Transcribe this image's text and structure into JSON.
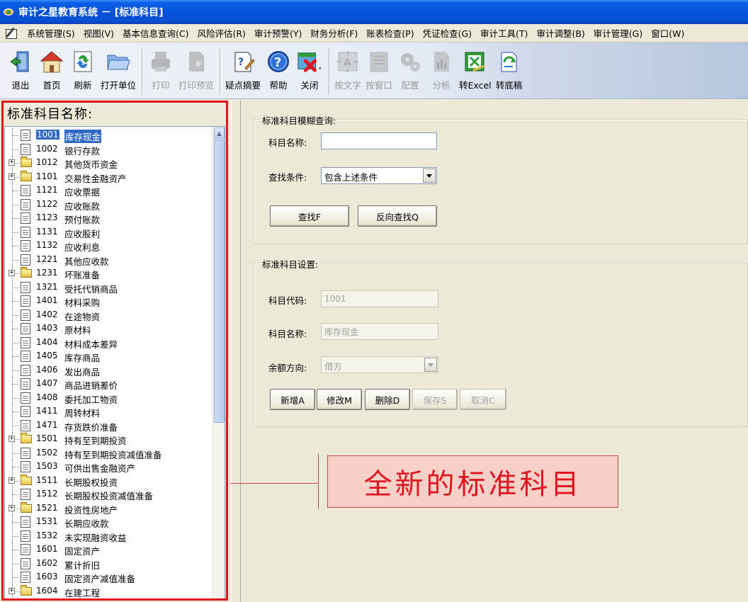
{
  "window": {
    "title": "审计之星教育系统 － [标准科目]"
  },
  "menu": [
    "系统管理(S)",
    "视图(V)",
    "基本信息查询(C)",
    "风险评估(R)",
    "审计预警(Y)",
    "财务分析(F)",
    "账表检查(P)",
    "凭证检查(G)",
    "审计工具(T)",
    "审计调整(B)",
    "审计管理(G)",
    "窗口(W)"
  ],
  "toolbar": {
    "exit": "退出",
    "home": "首页",
    "refresh": "刷新",
    "open_unit": "打开单位",
    "print": "打印",
    "print_preview": "打印预览",
    "doubt_summary": "疑点摘要",
    "help": "帮助",
    "close": "关闭",
    "by_text": "按文字",
    "by_window": "按窗口",
    "config": "配置",
    "analyze": "分析",
    "to_excel": "转Excel",
    "to_draft": "转底稿"
  },
  "left": {
    "title": "标准科目名称:",
    "tree": [
      {
        "code": "1001",
        "name": "库存现金",
        "type": "doc",
        "selected": true
      },
      {
        "code": "1002",
        "name": "银行存款",
        "type": "doc"
      },
      {
        "code": "1012",
        "name": "其他货币资金",
        "type": "folder"
      },
      {
        "code": "1101",
        "name": "交易性金融资产",
        "type": "folder"
      },
      {
        "code": "1121",
        "name": "应收票据",
        "type": "doc"
      },
      {
        "code": "1122",
        "name": "应收账款",
        "type": "doc"
      },
      {
        "code": "1123",
        "name": "预付账款",
        "type": "doc"
      },
      {
        "code": "1131",
        "name": "应收股利",
        "type": "doc"
      },
      {
        "code": "1132",
        "name": "应收利息",
        "type": "doc"
      },
      {
        "code": "1221",
        "name": "其他应收款",
        "type": "doc"
      },
      {
        "code": "1231",
        "name": "坏账准备",
        "type": "folder"
      },
      {
        "code": "1321",
        "name": "受托代销商品",
        "type": "doc"
      },
      {
        "code": "1401",
        "name": "材料采购",
        "type": "doc"
      },
      {
        "code": "1402",
        "name": "在途物资",
        "type": "doc"
      },
      {
        "code": "1403",
        "name": "原材料",
        "type": "doc"
      },
      {
        "code": "1404",
        "name": "材料成本差异",
        "type": "doc"
      },
      {
        "code": "1405",
        "name": "库存商品",
        "type": "doc"
      },
      {
        "code": "1406",
        "name": "发出商品",
        "type": "doc"
      },
      {
        "code": "1407",
        "name": "商品进销差价",
        "type": "doc"
      },
      {
        "code": "1408",
        "name": "委托加工物资",
        "type": "doc"
      },
      {
        "code": "1411",
        "name": "周转材料",
        "type": "doc"
      },
      {
        "code": "1471",
        "name": "存货跌价准备",
        "type": "doc"
      },
      {
        "code": "1501",
        "name": "持有至到期投资",
        "type": "folder"
      },
      {
        "code": "1502",
        "name": "持有至到期投资减值准备",
        "type": "doc"
      },
      {
        "code": "1503",
        "name": "可供出售金融资产",
        "type": "doc"
      },
      {
        "code": "1511",
        "name": "长期股权投资",
        "type": "folder"
      },
      {
        "code": "1512",
        "name": "长期股权投资减值准备",
        "type": "doc"
      },
      {
        "code": "1521",
        "name": "投资性房地产",
        "type": "folder"
      },
      {
        "code": "1531",
        "name": "长期应收款",
        "type": "doc"
      },
      {
        "code": "1532",
        "name": "未实现融资收益",
        "type": "doc"
      },
      {
        "code": "1601",
        "name": "固定资产",
        "type": "doc"
      },
      {
        "code": "1602",
        "name": "累计折旧",
        "type": "doc"
      },
      {
        "code": "1603",
        "name": "固定资产减值准备",
        "type": "doc"
      },
      {
        "code": "1604",
        "name": "在建工程",
        "type": "folder"
      }
    ]
  },
  "search": {
    "title": "标准科目模糊查询:",
    "name_label": "科目名称:",
    "name_value": "",
    "condition_label": "查找条件:",
    "condition_value": "包含上述条件",
    "find_button": "查找F",
    "reverse_find_button": "反向查找Q"
  },
  "settings": {
    "title": "标准科目设置:",
    "code_label": "科目代码:",
    "code_value": "1001",
    "name_label": "科目名称:",
    "name_value": "库存现金",
    "direction_label": "余额方向:",
    "direction_value": "借方",
    "buttons": {
      "add": "新增A",
      "modify": "修改M",
      "delete": "删除D",
      "save": "保存S",
      "cancel": "取消C"
    }
  },
  "callout": {
    "text": "全新的标准科目"
  }
}
